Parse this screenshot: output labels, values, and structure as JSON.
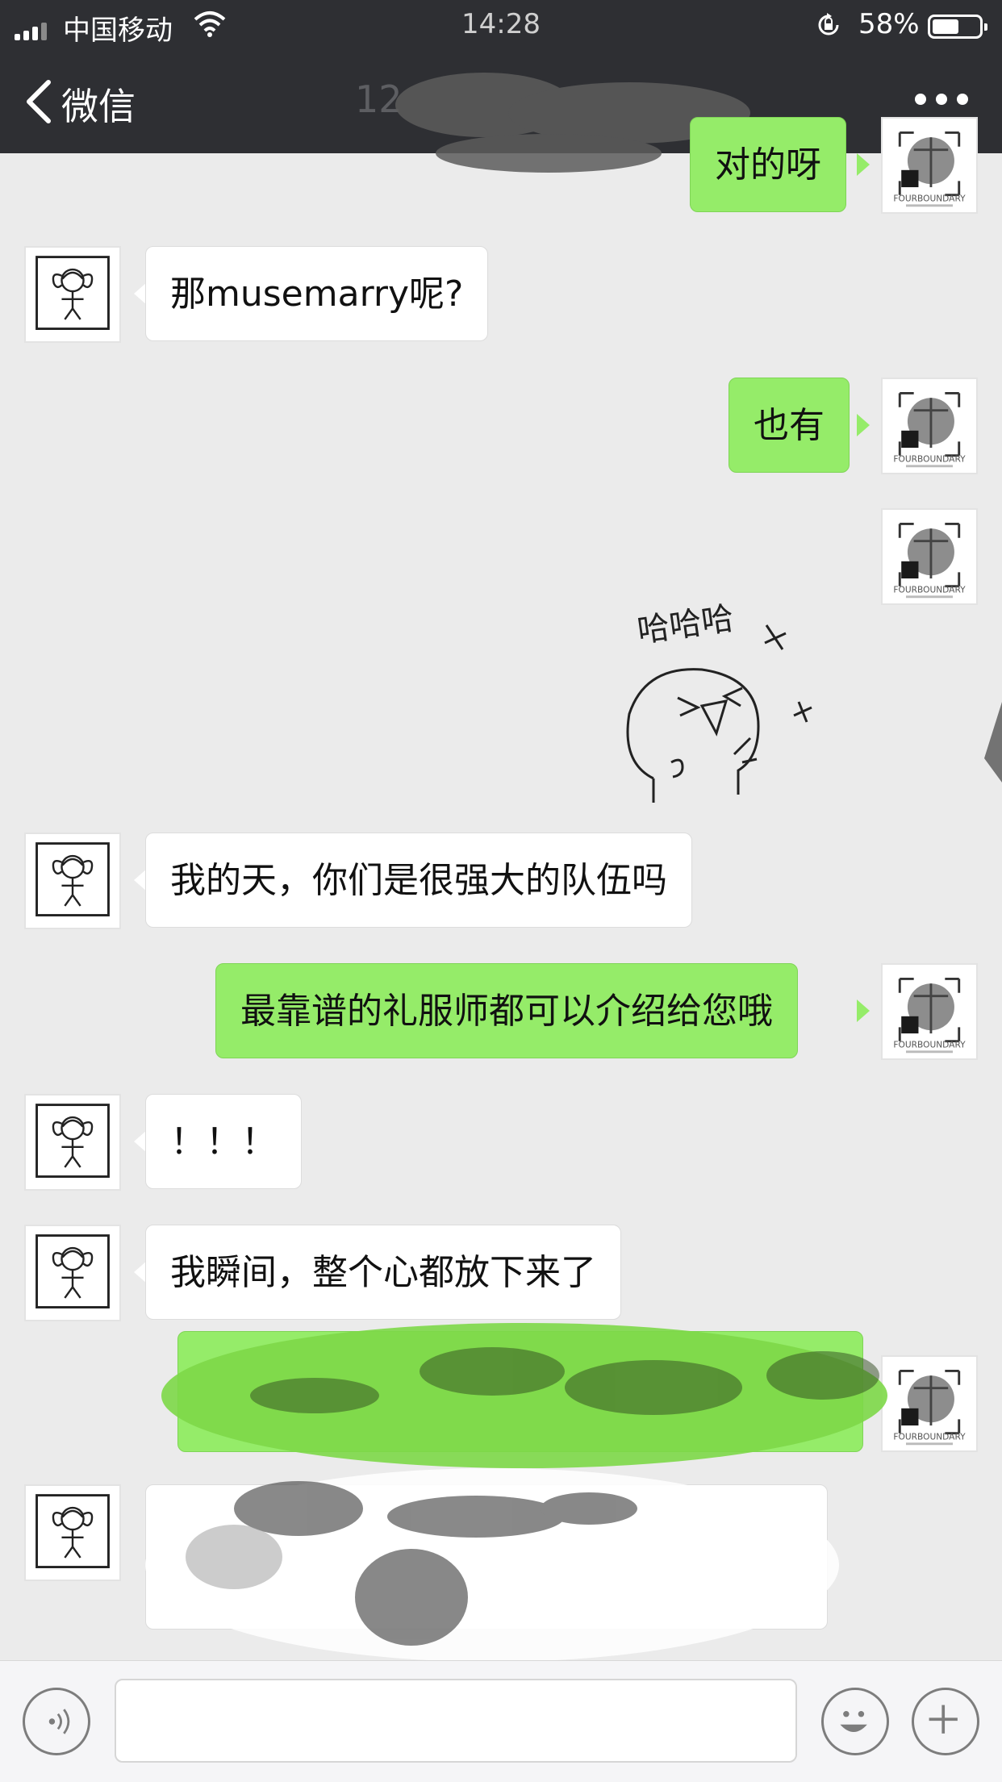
{
  "status_bar": {
    "carrier": "中国移动",
    "time": "14:28",
    "battery_percent": "58%",
    "battery_level": 0.58,
    "icons": [
      "signal-icon",
      "wifi-icon",
      "orientation-lock-icon",
      "battery-icon"
    ]
  },
  "nav": {
    "back_label": "微信",
    "title": "12",
    "icons": [
      "chevron-left-icon",
      "more-dots-icon"
    ]
  },
  "messages": [
    {
      "from": "me",
      "text": "对的呀"
    },
    {
      "from": "them",
      "text": "那musemarry呢?"
    },
    {
      "from": "me",
      "text": "也有"
    },
    {
      "from": "me",
      "type": "sticker",
      "text": "哈哈哈"
    },
    {
      "from": "them",
      "text": "我的天，你们是很强大的队伍吗"
    },
    {
      "from": "me",
      "text": "最靠谱的礼服师都可以介绍给您哦"
    },
    {
      "from": "them",
      "text": "！！！"
    },
    {
      "from": "them",
      "text": "我瞬间，整个心都放下来了"
    },
    {
      "from": "me",
      "text": ""
    },
    {
      "from": "them",
      "text": ""
    }
  ],
  "brand_avatar": {
    "name": "FOURBOUNDARY"
  },
  "input_bar": {
    "value": "",
    "icons": [
      "voice-icon",
      "emoji-icon",
      "plus-icon"
    ]
  },
  "colors": {
    "nav_bg": "#2e2f33",
    "chat_bg": "#ebebeb",
    "outgoing_bubble": "#95ec69",
    "incoming_bubble": "#ffffff"
  }
}
